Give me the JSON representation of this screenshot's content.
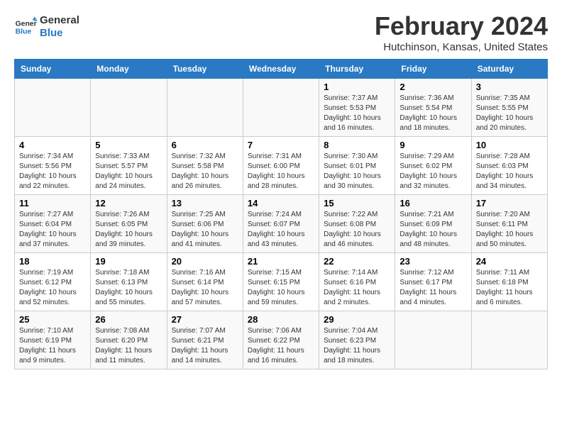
{
  "logo": {
    "line1": "General",
    "line2": "Blue"
  },
  "title": "February 2024",
  "location": "Hutchinson, Kansas, United States",
  "weekdays": [
    "Sunday",
    "Monday",
    "Tuesday",
    "Wednesday",
    "Thursday",
    "Friday",
    "Saturday"
  ],
  "weeks": [
    [
      {
        "day": "",
        "info": ""
      },
      {
        "day": "",
        "info": ""
      },
      {
        "day": "",
        "info": ""
      },
      {
        "day": "",
        "info": ""
      },
      {
        "day": "1",
        "info": "Sunrise: 7:37 AM\nSunset: 5:53 PM\nDaylight: 10 hours\nand 16 minutes."
      },
      {
        "day": "2",
        "info": "Sunrise: 7:36 AM\nSunset: 5:54 PM\nDaylight: 10 hours\nand 18 minutes."
      },
      {
        "day": "3",
        "info": "Sunrise: 7:35 AM\nSunset: 5:55 PM\nDaylight: 10 hours\nand 20 minutes."
      }
    ],
    [
      {
        "day": "4",
        "info": "Sunrise: 7:34 AM\nSunset: 5:56 PM\nDaylight: 10 hours\nand 22 minutes."
      },
      {
        "day": "5",
        "info": "Sunrise: 7:33 AM\nSunset: 5:57 PM\nDaylight: 10 hours\nand 24 minutes."
      },
      {
        "day": "6",
        "info": "Sunrise: 7:32 AM\nSunset: 5:58 PM\nDaylight: 10 hours\nand 26 minutes."
      },
      {
        "day": "7",
        "info": "Sunrise: 7:31 AM\nSunset: 6:00 PM\nDaylight: 10 hours\nand 28 minutes."
      },
      {
        "day": "8",
        "info": "Sunrise: 7:30 AM\nSunset: 6:01 PM\nDaylight: 10 hours\nand 30 minutes."
      },
      {
        "day": "9",
        "info": "Sunrise: 7:29 AM\nSunset: 6:02 PM\nDaylight: 10 hours\nand 32 minutes."
      },
      {
        "day": "10",
        "info": "Sunrise: 7:28 AM\nSunset: 6:03 PM\nDaylight: 10 hours\nand 34 minutes."
      }
    ],
    [
      {
        "day": "11",
        "info": "Sunrise: 7:27 AM\nSunset: 6:04 PM\nDaylight: 10 hours\nand 37 minutes."
      },
      {
        "day": "12",
        "info": "Sunrise: 7:26 AM\nSunset: 6:05 PM\nDaylight: 10 hours\nand 39 minutes."
      },
      {
        "day": "13",
        "info": "Sunrise: 7:25 AM\nSunset: 6:06 PM\nDaylight: 10 hours\nand 41 minutes."
      },
      {
        "day": "14",
        "info": "Sunrise: 7:24 AM\nSunset: 6:07 PM\nDaylight: 10 hours\nand 43 minutes."
      },
      {
        "day": "15",
        "info": "Sunrise: 7:22 AM\nSunset: 6:08 PM\nDaylight: 10 hours\nand 46 minutes."
      },
      {
        "day": "16",
        "info": "Sunrise: 7:21 AM\nSunset: 6:09 PM\nDaylight: 10 hours\nand 48 minutes."
      },
      {
        "day": "17",
        "info": "Sunrise: 7:20 AM\nSunset: 6:11 PM\nDaylight: 10 hours\nand 50 minutes."
      }
    ],
    [
      {
        "day": "18",
        "info": "Sunrise: 7:19 AM\nSunset: 6:12 PM\nDaylight: 10 hours\nand 52 minutes."
      },
      {
        "day": "19",
        "info": "Sunrise: 7:18 AM\nSunset: 6:13 PM\nDaylight: 10 hours\nand 55 minutes."
      },
      {
        "day": "20",
        "info": "Sunrise: 7:16 AM\nSunset: 6:14 PM\nDaylight: 10 hours\nand 57 minutes."
      },
      {
        "day": "21",
        "info": "Sunrise: 7:15 AM\nSunset: 6:15 PM\nDaylight: 10 hours\nand 59 minutes."
      },
      {
        "day": "22",
        "info": "Sunrise: 7:14 AM\nSunset: 6:16 PM\nDaylight: 11 hours\nand 2 minutes."
      },
      {
        "day": "23",
        "info": "Sunrise: 7:12 AM\nSunset: 6:17 PM\nDaylight: 11 hours\nand 4 minutes."
      },
      {
        "day": "24",
        "info": "Sunrise: 7:11 AM\nSunset: 6:18 PM\nDaylight: 11 hours\nand 6 minutes."
      }
    ],
    [
      {
        "day": "25",
        "info": "Sunrise: 7:10 AM\nSunset: 6:19 PM\nDaylight: 11 hours\nand 9 minutes."
      },
      {
        "day": "26",
        "info": "Sunrise: 7:08 AM\nSunset: 6:20 PM\nDaylight: 11 hours\nand 11 minutes."
      },
      {
        "day": "27",
        "info": "Sunrise: 7:07 AM\nSunset: 6:21 PM\nDaylight: 11 hours\nand 14 minutes."
      },
      {
        "day": "28",
        "info": "Sunrise: 7:06 AM\nSunset: 6:22 PM\nDaylight: 11 hours\nand 16 minutes."
      },
      {
        "day": "29",
        "info": "Sunrise: 7:04 AM\nSunset: 6:23 PM\nDaylight: 11 hours\nand 18 minutes."
      },
      {
        "day": "",
        "info": ""
      },
      {
        "day": "",
        "info": ""
      }
    ]
  ]
}
